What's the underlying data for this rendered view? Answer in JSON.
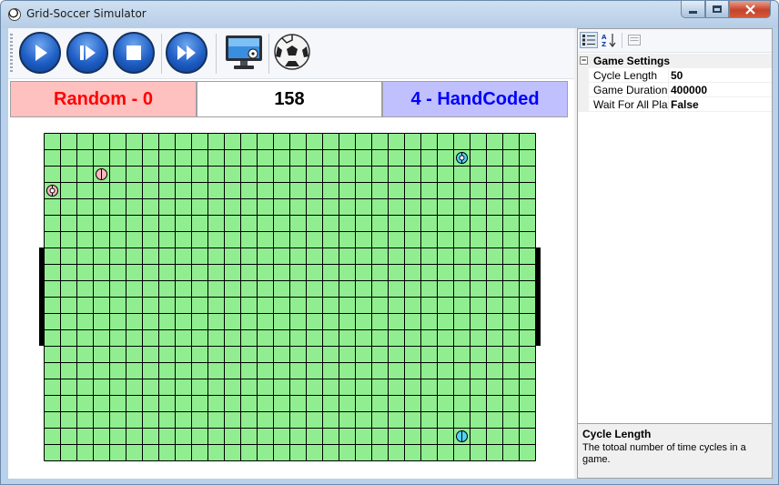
{
  "window": {
    "title": "Grid-Soccer Simulator"
  },
  "toolbar": {
    "buttons": [
      {
        "name": "play-button",
        "icon": "play-icon"
      },
      {
        "name": "step-button",
        "icon": "step-forward-icon"
      },
      {
        "name": "stop-button",
        "icon": "stop-icon"
      },
      {
        "name": "fast-forward-button",
        "icon": "fast-forward-icon"
      },
      {
        "name": "monitor-button",
        "icon": "monitor-icon"
      },
      {
        "name": "soccer-ball-button",
        "icon": "soccer-ball-icon"
      }
    ]
  },
  "scoreboard": {
    "left": "Random - 0",
    "cycle": "158",
    "right": "4 - HandCoded",
    "left_color": "#ff0000",
    "right_color": "#0000ff",
    "left_bg": "#ffc0c0",
    "right_bg": "#c0c0ff"
  },
  "field": {
    "cols": 30,
    "rows": 20,
    "grass_color": "#90ee90",
    "line_color": "#000000",
    "players": [
      {
        "team": "blue",
        "col": 25,
        "row": 1,
        "color": "#4fd3f5",
        "has_ball": true
      },
      {
        "team": "pink",
        "col": 3,
        "row": 2,
        "color": "#ffb6c1",
        "has_ball": false
      },
      {
        "team": "pink",
        "col": 0,
        "row": 3,
        "color": "#ffb6c1",
        "has_ball": true
      },
      {
        "team": "blue",
        "col": 25,
        "row": 18,
        "color": "#4fd3f5",
        "has_ball": false
      }
    ]
  },
  "property_grid": {
    "category": "Game Settings",
    "rows": [
      {
        "name": "Cycle Length",
        "value": "50"
      },
      {
        "name": "Game Duration",
        "value": "400000"
      },
      {
        "name": "Wait For All Players",
        "value": "False"
      }
    ],
    "help": {
      "title": "Cycle Length",
      "description": "The totoal number of time cycles in a game."
    }
  }
}
